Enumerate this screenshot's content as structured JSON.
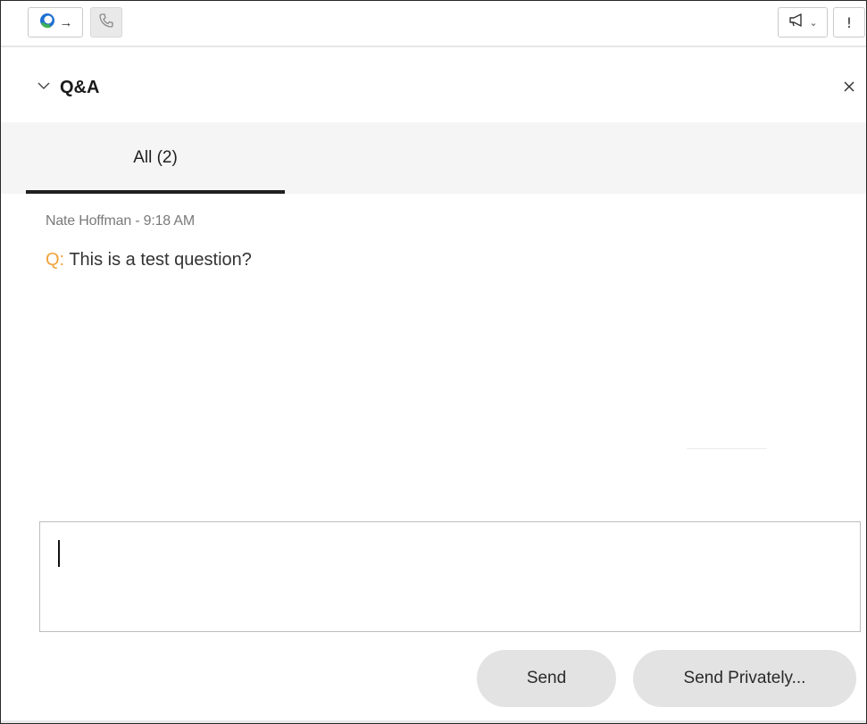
{
  "toolbar": {
    "join_icon": "webex-logo-arrow-icon",
    "phone_icon": "phone-icon",
    "announce_icon": "megaphone-icon",
    "more_glyph": "!",
    "colors": {
      "logo_blue": "#1e6fd0",
      "logo_green": "#3fb34f"
    }
  },
  "panel": {
    "title": "Q&A",
    "collapse_icon": "chevron-down-icon",
    "close_icon": "close-icon"
  },
  "tabs": [
    {
      "label": "All (2)",
      "selected": true
    }
  ],
  "messages": [
    {
      "meta": "Nate Hoffman - 9:18 AM",
      "prefix": "Q:",
      "text": "This is a test question?"
    }
  ],
  "compose": {
    "value": "",
    "placeholder": ""
  },
  "buttons": {
    "send": "Send",
    "send_privately": "Send Privately..."
  },
  "colors": {
    "question_prefix": "#f0a23a",
    "button_bg": "#e3e3e3",
    "tab_bar_bg": "#f5f5f5"
  }
}
